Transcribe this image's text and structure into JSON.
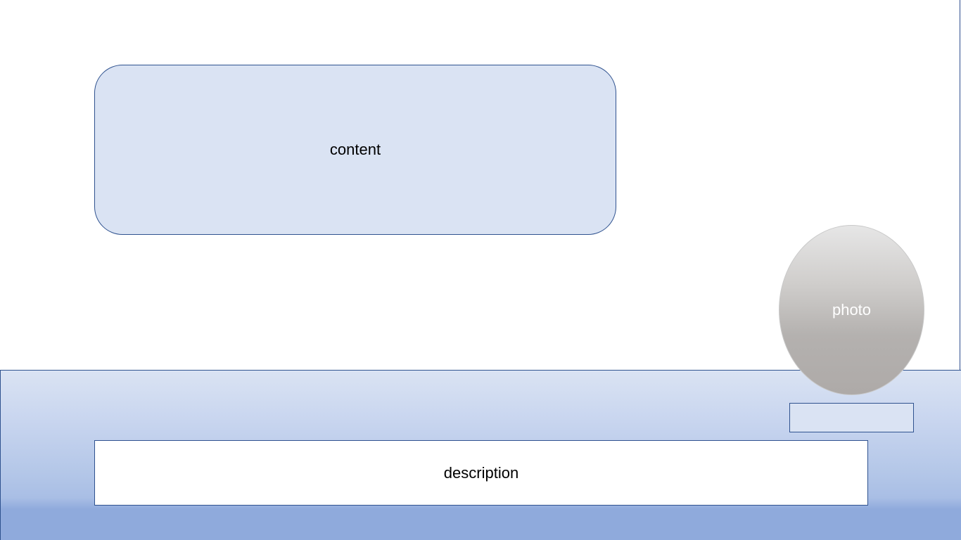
{
  "content_box": {
    "label": "content"
  },
  "photo_placeholder": {
    "label": "photo"
  },
  "description_box": {
    "label": "description"
  },
  "colors": {
    "box_fill": "#dae3f3",
    "box_border": "#2f528f",
    "band_bottom": "#8faadc",
    "photo_top": "#e6e6e6",
    "photo_bottom": "#aeaaa8"
  }
}
